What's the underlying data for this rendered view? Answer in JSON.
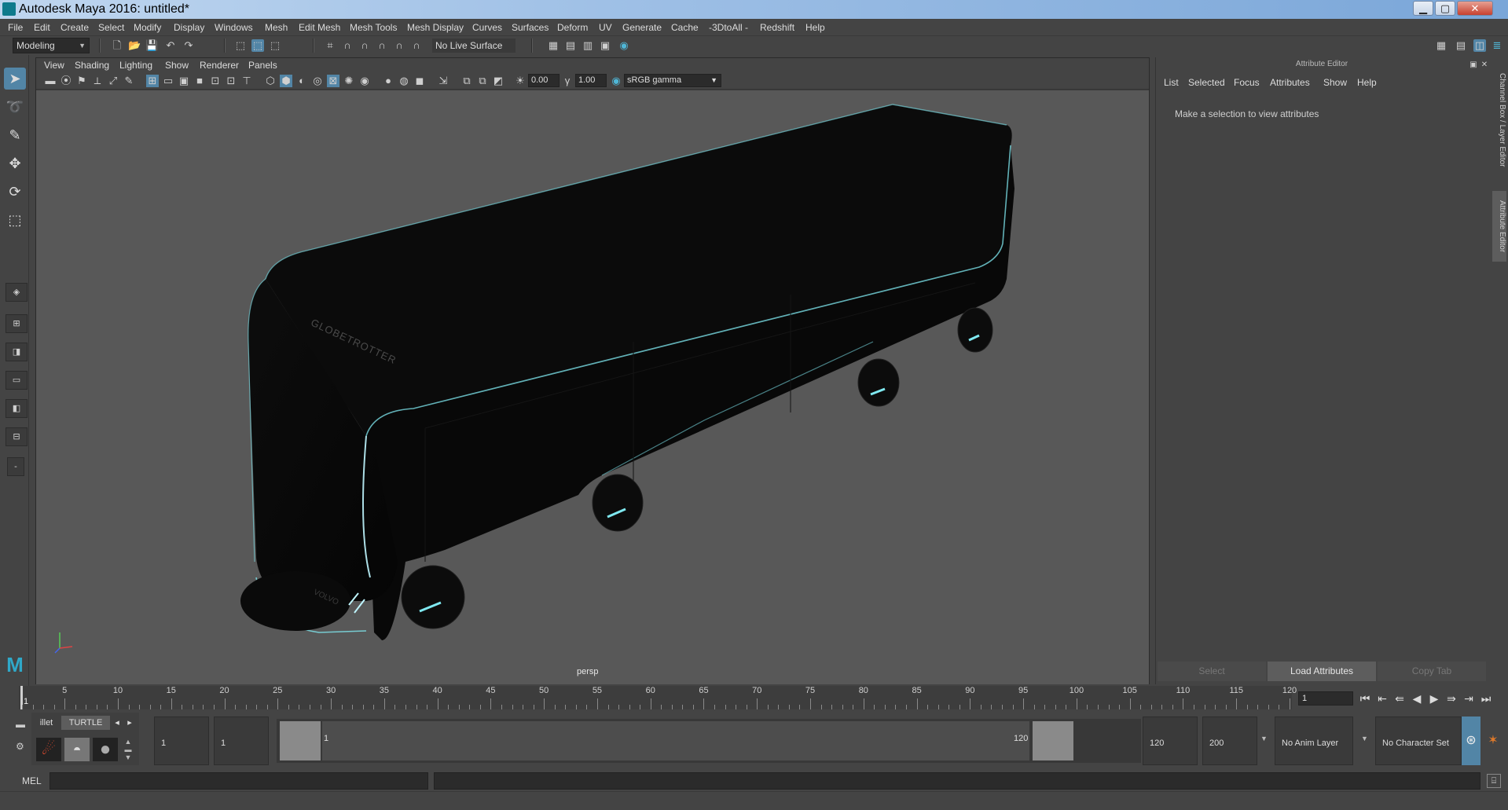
{
  "window": {
    "title": "Autodesk Maya 2016: untitled*",
    "minimize_icon": "minimize-icon",
    "maximize_icon": "maximize-icon",
    "close_icon": "close-icon"
  },
  "menubar": {
    "items": [
      "File",
      "Edit",
      "Create",
      "Select",
      "Modify",
      "Display",
      "Windows",
      "Mesh",
      "Edit Mesh",
      "Mesh Tools",
      "Mesh Display",
      "Curves",
      "Surfaces",
      "Deform",
      "UV",
      "Generate",
      "Cache",
      "-3DtoAll -",
      "Redshift",
      "Help"
    ]
  },
  "statusline": {
    "mode": "Modeling",
    "live_surface": "No Live Surface"
  },
  "viewport": {
    "menu": [
      "View",
      "Shading",
      "Lighting",
      "Show",
      "Renderer",
      "Panels"
    ],
    "exposure": "0.00",
    "gamma": "1.00",
    "color_space": "sRGB gamma",
    "camera_label": "persp",
    "model_text_1": "GLOBETROTTER",
    "model_text_2": "VOLVO"
  },
  "attribute_editor": {
    "header": "Attribute Editor",
    "menu": [
      "List",
      "Selected",
      "Focus",
      "Attributes",
      "Show",
      "Help"
    ],
    "message": "Make a selection to view attributes",
    "buttons": {
      "select": "Select",
      "load": "Load Attributes",
      "copy_tab": "Copy Tab"
    }
  },
  "side_tabs": {
    "channel_box": "Channel Box / Layer Editor",
    "attribute_editor": "Attribute Editor"
  },
  "timeline": {
    "labels": [
      "5",
      "10",
      "15",
      "20",
      "25",
      "30",
      "35",
      "40",
      "45",
      "50",
      "55",
      "60",
      "65",
      "70",
      "75",
      "80",
      "85",
      "90",
      "95",
      "100",
      "105",
      "110",
      "115",
      "120"
    ],
    "start_label": "1",
    "current_frame": "1"
  },
  "range_slider": {
    "start_time": "1",
    "playback_start": "1",
    "range_start_label": "1",
    "range_end_label": "120",
    "playback_end": "120",
    "end_time": "200",
    "anim_layer": "No Anim Layer",
    "character_set": "No Character Set"
  },
  "shelf": {
    "tabs": [
      "illet",
      "TURTLE"
    ]
  },
  "command_line": {
    "label": "MEL"
  },
  "colors": {
    "accent": "#5285a6",
    "button_active": "#5d5d5d",
    "model_edge": "#7fe8f0"
  }
}
